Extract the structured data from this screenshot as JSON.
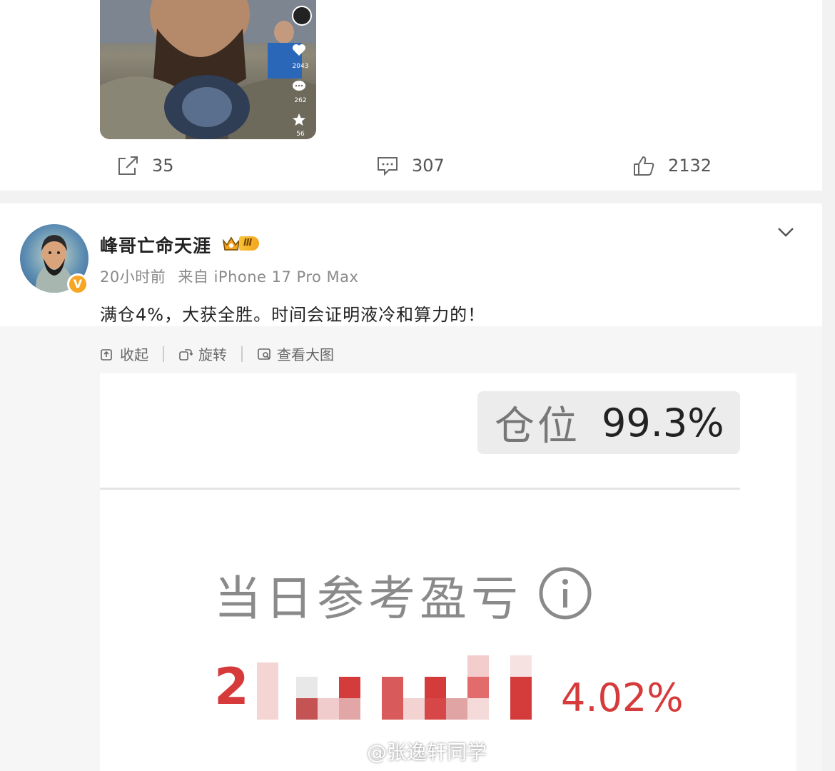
{
  "prev_post": {
    "video_stats": {
      "likes": "2043",
      "comments": "262",
      "favorites": "56"
    },
    "actions": {
      "share_count": "35",
      "comment_count": "307",
      "like_count": "2132"
    }
  },
  "post": {
    "username": "峰哥亡命天涯",
    "vip_level": "Ⅲ",
    "verified_mark": "V",
    "time": "20小时前",
    "source": "来自 iPhone 17 Pro Max",
    "text": "满仓4%，大获全胜。时间会证明液冷和算力的！",
    "image_tools": {
      "collapse": "收起",
      "rotate": "旋转",
      "view_large": "查看大图"
    },
    "screenshot": {
      "position_label": "仓位",
      "position_value": "99.3%",
      "pnl_label": "当日参考盈亏",
      "pnl_amount_visible": "2",
      "pnl_percent": "4.02%"
    }
  },
  "watermark": "@张逸轩同学",
  "colors": {
    "accent_red": "#d63a3a",
    "vip_gold": "#f3a41c",
    "verified_orange": "#f6a623"
  }
}
